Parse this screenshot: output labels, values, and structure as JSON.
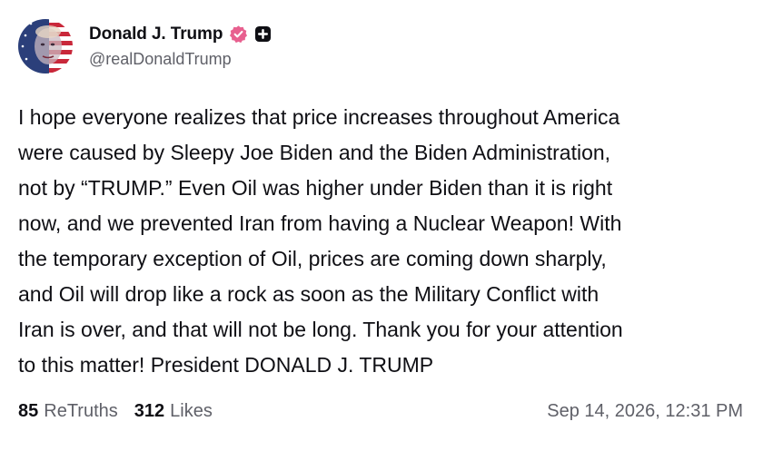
{
  "author": {
    "display_name": "Donald J. Trump",
    "handle": "@realDonaldTrump",
    "verified_badge_color": "#e8608f"
  },
  "post": {
    "text": "I hope everyone realizes that price increases throughout America\nwere caused by Sleepy Joe Biden and the Biden Administration,\nnot by “TRUMP.” Even Oil was higher under Biden than it is right\nnow, and we prevented Iran from having a Nuclear Weapon! With\nthe temporary exception of Oil, prices are coming down sharply,\nand Oil will drop like a rock as soon as the Military Conflict with\nIran is over, and that will not be long. Thank you for your attention\nto this matter! President DONALD J. TRUMP"
  },
  "stats": {
    "retruths_count": "85",
    "retruths_label": "ReTruths",
    "likes_count": "312",
    "likes_label": "Likes"
  },
  "timestamp": "Sep 14, 2026, 12:31 PM",
  "icons": {
    "verified": "verified-badge-icon",
    "plus": "plus-badge-icon"
  }
}
